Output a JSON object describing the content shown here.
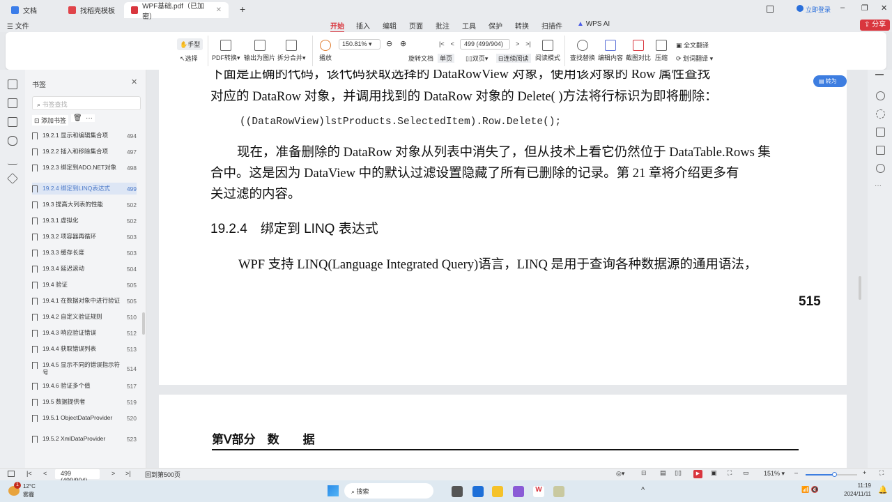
{
  "tabs": [
    {
      "label": "文档",
      "color": "#3b7de9"
    },
    {
      "label": "找稻壳模板",
      "color": "#e0444a"
    },
    {
      "label": "WPF基础.pdf（已加密）",
      "color": "#d9363e",
      "active": true
    }
  ],
  "titlebar": {
    "login": "立即登录"
  },
  "menu": {
    "file": "文件",
    "items": [
      "开始",
      "插入",
      "编辑",
      "页面",
      "批注",
      "工具",
      "保护",
      "转换",
      "扫描件"
    ],
    "ai": "WPS AI",
    "share": "分享"
  },
  "ribbon": {
    "hand": "手型",
    "select": "选择",
    "pdf_convert": "PDF转换",
    "export_image": "输出为图片",
    "split_merge": "拆分合并",
    "play": "播放",
    "zoom": "150.81%",
    "page_input": "499 (499/904)",
    "rotate": "旋转文档",
    "single": "单页",
    "double": "双页",
    "continuous": "连续阅读",
    "read_mode": "阅读模式",
    "find_replace": "查找替换",
    "edit_content": "编辑内容",
    "screenshot_compare": "截图对比",
    "compress": "压缩",
    "full_translate": "全文翻译",
    "word_translate": "划词翻译"
  },
  "sidebar": {
    "title": "书签",
    "search_placeholder": "书签查找",
    "add_bookmark": "添加书签",
    "items": [
      {
        "label": "19.2.1 显示和编辑集合项",
        "page": "494"
      },
      {
        "label": "19.2.2 插入和移除集合项",
        "page": "497"
      },
      {
        "label": "19.2.3 绑定到ADO.NET对象",
        "page": "498"
      },
      {
        "label": "19.2.4 绑定到LINQ表达式",
        "page": "499",
        "selected": true
      },
      {
        "label": "19.3 提高大列表的性能",
        "page": "502"
      },
      {
        "label": "19.3.1 虚拟化",
        "page": "502"
      },
      {
        "label": "19.3.2 项容器再循环",
        "page": "503"
      },
      {
        "label": "19.3.3 缓存长度",
        "page": "503"
      },
      {
        "label": "19.3.4 延迟滚动",
        "page": "504"
      },
      {
        "label": "19.4 验证",
        "page": "505"
      },
      {
        "label": "19.4.1 在数据对象中进行验证",
        "page": "505"
      },
      {
        "label": "19.4.2 自定义验证规则",
        "page": "510"
      },
      {
        "label": "19.4.3 响应验证错误",
        "page": "512"
      },
      {
        "label": "19.4.4 获取错误列表",
        "page": "513"
      },
      {
        "label": "19.4.5 显示不同的错误指示符号",
        "page": "514"
      },
      {
        "label": "19.4.6 验证多个值",
        "page": "517"
      },
      {
        "label": "19.5 数据提供者",
        "page": "519"
      },
      {
        "label": "19.5.1 ObjectDataProvider",
        "page": "520"
      },
      {
        "label": "19.5.2 XmlDataProvider",
        "page": "523"
      }
    ]
  },
  "document": {
    "lines": [
      "下面是正确的代码，该代码获取选择的 DataRowView 对象，使用该对象的 Row 属性查找",
      "对应的 DataRow 对象，并调用找到的 DataRow 对象的 Delete( )方法将行标识为即将删除："
    ],
    "code": "((DataRowView)lstProducts.SelectedItem).Row.Delete();",
    "para2": [
      "现在，准备删除的 DataRow 对象从列表中消失了，但从技术上看它仍然位于 DataTable.Rows 集",
      "合中。这是因为 DataView 中的默认过滤设置隐藏了所有已删除的记录。第 21 章将介绍更多有",
      "关过滤的内容。"
    ],
    "heading": "19.2.4　绑定到 LINQ 表达式",
    "para3": "WPF 支持 LINQ(Language Integrated Query)语言，LINQ 是用于查询各种数据源的通用语法，",
    "page_number": "515",
    "next_heading": "第Ⅴ部分　数　　据",
    "to_word": "转为Word"
  },
  "statusbar": {
    "page_input": "499 (499/904)",
    "back": "回到第500页",
    "zoom": "151%",
    "zoom_fraction": 0.55
  },
  "taskbar": {
    "temp": "12°C",
    "weather": "雾霾",
    "badge": "1",
    "search": "搜索",
    "time": "11:19",
    "date": "2024/11/11"
  }
}
